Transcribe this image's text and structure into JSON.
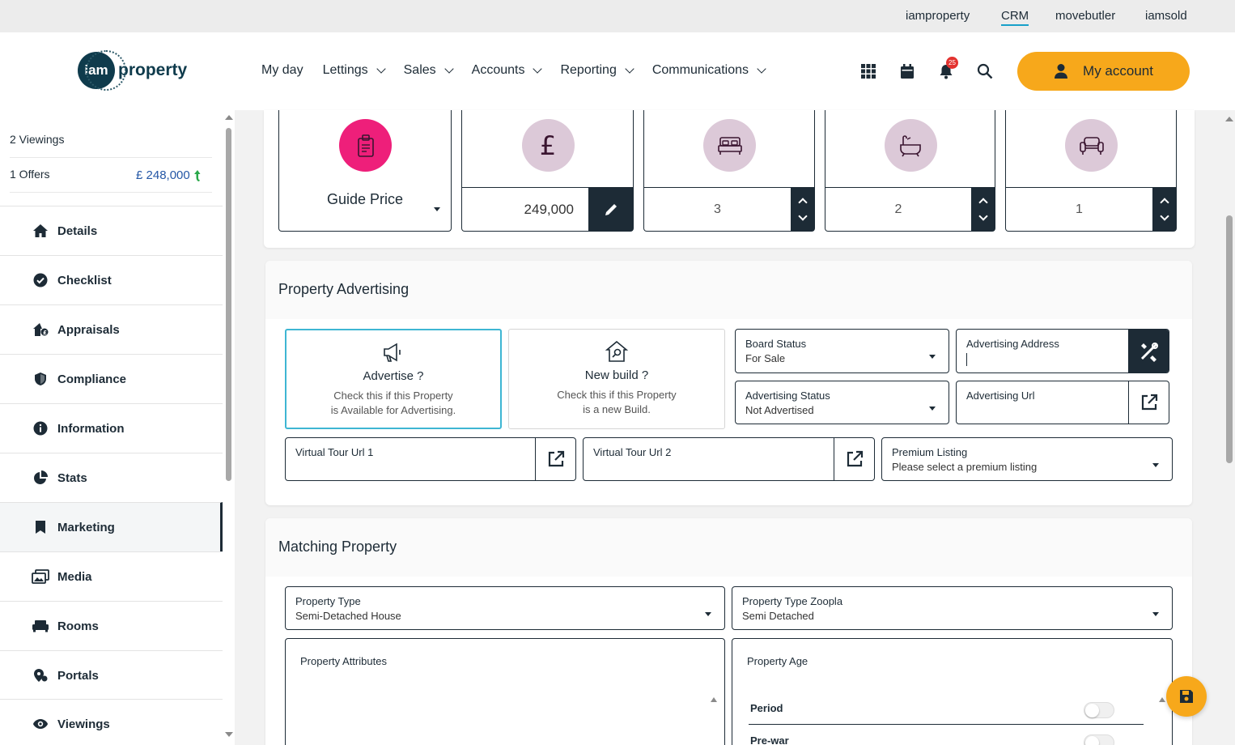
{
  "top_links": [
    "iamproperty",
    "CRM",
    "movebutler",
    "iamsold"
  ],
  "header": {
    "logo_left": "iam",
    "logo_right": "property",
    "nav": [
      "My day",
      "Lettings",
      "Sales",
      "Accounts",
      "Reporting",
      "Communications"
    ],
    "notification_count": "25",
    "account_label": "My account"
  },
  "colors": {
    "accent": "#f7a81b",
    "dark": "#1d2b36",
    "pink": "#ee1f7a",
    "lilac": "#dcc9d8",
    "highlight": "#3eb6d3"
  },
  "sidebar": {
    "viewings": "2 Viewings",
    "offers": "1 Offers",
    "offer_value": "£ 248,000",
    "items": [
      {
        "label": "Details",
        "icon": "home-icon"
      },
      {
        "label": "Checklist",
        "icon": "check-circle-icon"
      },
      {
        "label": "Appraisals",
        "icon": "house-price-icon"
      },
      {
        "label": "Compliance",
        "icon": "shield-icon"
      },
      {
        "label": "Information",
        "icon": "info-icon"
      },
      {
        "label": "Stats",
        "icon": "pie-chart-icon"
      },
      {
        "label": "Marketing",
        "icon": "bookmark-icon"
      },
      {
        "label": "Media",
        "icon": "images-icon"
      },
      {
        "label": "Rooms",
        "icon": "sofa-icon"
      },
      {
        "label": "Portals",
        "icon": "map-pin-icon"
      },
      {
        "label": "Viewings",
        "icon": "eye-icon"
      }
    ],
    "active": "Marketing"
  },
  "tiles": {
    "price_type": "Guide Price",
    "price": "249,000",
    "bedrooms": "3",
    "bathrooms": "2",
    "receptions": "1"
  },
  "advertising": {
    "title": "Property Advertising",
    "advertise": {
      "title": "Advertise ?",
      "desc1": "Check this if this Property",
      "desc2": "is Available for Advertising."
    },
    "new_build": {
      "title": "New build ?",
      "desc1": "Check this if this Property",
      "desc2": "is a new Build."
    },
    "board_status": {
      "label": "Board Status",
      "value": "For Sale"
    },
    "advertising_address": {
      "label": "Advertising Address",
      "value": ""
    },
    "advertising_status": {
      "label": "Advertising Status",
      "value": "Not Advertised"
    },
    "advertising_url": {
      "label": "Advertising Url",
      "value": ""
    },
    "virtual_tour_1": {
      "label": "Virtual Tour Url 1",
      "value": ""
    },
    "virtual_tour_2": {
      "label": "Virtual Tour Url 2",
      "value": ""
    },
    "premium_listing": {
      "label": "Premium Listing",
      "value": "Please select a premium listing"
    }
  },
  "matching": {
    "title": "Matching Property",
    "property_type": {
      "label": "Property Type",
      "value": "Semi-Detached House"
    },
    "property_type_zoopla": {
      "label": "Property Type Zoopla",
      "value": "Semi Detached"
    },
    "attributes_label": "Property Attributes",
    "age_label": "Property Age",
    "age_options": [
      "Period",
      "Pre-war"
    ]
  }
}
